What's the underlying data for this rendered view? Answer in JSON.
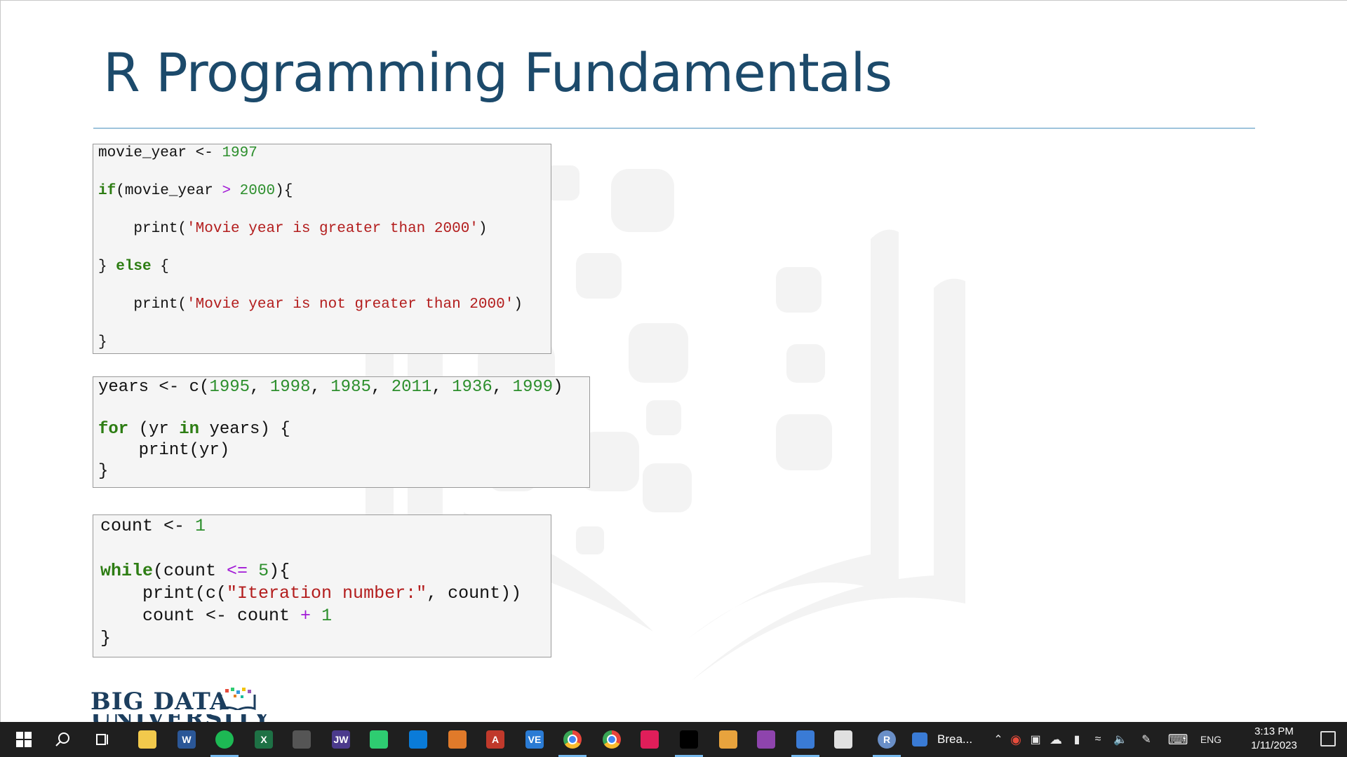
{
  "slide": {
    "title": "R Programming Fundamentals",
    "logo_text": "BIG DATA",
    "logo_text_line2": "UNIVERSITY"
  },
  "code_blocks": [
    {
      "lines": [
        [
          [
            "t",
            "movie_year <- "
          ],
          [
            "num",
            "1997"
          ]
        ],
        [
          [
            "kw",
            "if"
          ],
          [
            "t",
            "(movie_year "
          ],
          [
            "op",
            ">"
          ],
          [
            "t",
            " "
          ],
          [
            "num",
            "2000"
          ],
          [
            "t",
            "){"
          ]
        ],
        [
          [
            "t",
            "    print("
          ],
          [
            "str",
            "'Movie year is greater than 2000'"
          ],
          [
            "t",
            ")"
          ]
        ],
        [
          [
            "t",
            "} "
          ],
          [
            "kw",
            "else"
          ],
          [
            "t",
            " {"
          ]
        ],
        [
          [
            "t",
            "    print("
          ],
          [
            "str",
            "'Movie year is not greater than 2000'"
          ],
          [
            "t",
            ")"
          ]
        ],
        [
          [
            "t",
            "}"
          ]
        ]
      ]
    },
    {
      "lines": [
        [
          [
            "t",
            "years <- c("
          ],
          [
            "num",
            "1995"
          ],
          [
            "t",
            ", "
          ],
          [
            "num",
            "1998"
          ],
          [
            "t",
            ", "
          ],
          [
            "num",
            "1985"
          ],
          [
            "t",
            ", "
          ],
          [
            "num",
            "2011"
          ],
          [
            "t",
            ", "
          ],
          [
            "num",
            "1936"
          ],
          [
            "t",
            ", "
          ],
          [
            "num",
            "1999"
          ],
          [
            "t",
            ")"
          ]
        ],
        [
          [
            "t",
            ""
          ]
        ],
        [
          [
            "kw",
            "for"
          ],
          [
            "t",
            " (yr "
          ],
          [
            "kw",
            "in"
          ],
          [
            "t",
            " years) {"
          ]
        ],
        [
          [
            "t",
            "    print(yr)"
          ]
        ],
        [
          [
            "t",
            "}"
          ]
        ]
      ]
    },
    {
      "lines": [
        [
          [
            "t",
            "count <- "
          ],
          [
            "num",
            "1"
          ]
        ],
        [
          [
            "t",
            ""
          ]
        ],
        [
          [
            "kw",
            "while"
          ],
          [
            "t",
            "(count "
          ],
          [
            "op",
            "<="
          ],
          [
            "t",
            " "
          ],
          [
            "num",
            "5"
          ],
          [
            "t",
            "){"
          ]
        ],
        [
          [
            "t",
            "    print(c("
          ],
          [
            "str",
            "\"Iteration number:\""
          ],
          [
            "t",
            ", count))"
          ]
        ],
        [
          [
            "t",
            "    count <- count "
          ],
          [
            "op",
            "+"
          ],
          [
            "t",
            " "
          ],
          [
            "num",
            "1"
          ]
        ],
        [
          [
            "t",
            "}"
          ]
        ]
      ]
    }
  ],
  "taskbar": {
    "items": [
      {
        "name": "start-button",
        "icon": "windows-logo-icon"
      },
      {
        "name": "search-button",
        "icon": "search-icon"
      },
      {
        "name": "task-view-button",
        "icon": "task-view-icon"
      },
      {
        "name": "file-explorer",
        "icon": "folder-icon",
        "color": "#f2c94c"
      },
      {
        "name": "word",
        "icon": "word-icon",
        "label": "W",
        "color": "#2b5797"
      },
      {
        "name": "spotify",
        "icon": "spotify-icon",
        "color": "#1db954"
      },
      {
        "name": "excel",
        "icon": "excel-icon",
        "label": "X",
        "color": "#1e7145"
      },
      {
        "name": "calculator",
        "icon": "calculator-icon",
        "color": "#555555"
      },
      {
        "name": "jw-app",
        "icon": "jw-icon",
        "label": "JW",
        "color": "#4b3a8c"
      },
      {
        "name": "media-app",
        "icon": "play-icon",
        "color": "#2ecc71"
      },
      {
        "name": "vscode",
        "icon": "vscode-icon",
        "color": "#0a7bd8"
      },
      {
        "name": "matlab",
        "icon": "matlab-icon",
        "color": "#e07a2a"
      },
      {
        "name": "access",
        "icon": "access-icon",
        "label": "A",
        "color": "#c0392b"
      },
      {
        "name": "ve-app",
        "icon": "ve-icon",
        "label": "VE",
        "color": "#2a7bd4"
      },
      {
        "name": "chrome",
        "icon": "chrome-icon",
        "color": "#e8453c"
      },
      {
        "name": "chrome-profile",
        "icon": "chrome-profile-icon",
        "color": "#e8453c"
      },
      {
        "name": "slack",
        "icon": "slack-icon",
        "color": "#e01e5a"
      },
      {
        "name": "terminal",
        "icon": "terminal-icon",
        "color": "#000000"
      },
      {
        "name": "git-app",
        "icon": "git-icon",
        "color": "#e8a33d"
      },
      {
        "name": "drop-app",
        "icon": "drop-icon",
        "color": "#8e44ad"
      },
      {
        "name": "virtualbox",
        "icon": "cube-icon",
        "color": "#3a7bd5"
      },
      {
        "name": "reader-app",
        "icon": "reader-icon",
        "color": "#e0e0e0"
      },
      {
        "name": "r-app",
        "icon": "r-icon",
        "label": "R",
        "color": "#6a8fc7"
      },
      {
        "name": "news-widget",
        "icon": "news-icon",
        "label": "Brea...",
        "color": "#3a7bd5"
      }
    ],
    "tray": {
      "language": "ENG",
      "time": "3:13 PM",
      "date": "1/11/2023"
    }
  },
  "colors": {
    "title": "#1c4a6b",
    "rule": "#9ec3dc",
    "keyword": "#2d7d13",
    "number": "#2d8f2d",
    "string": "#b31d1d",
    "operator": "#a21ad6"
  }
}
